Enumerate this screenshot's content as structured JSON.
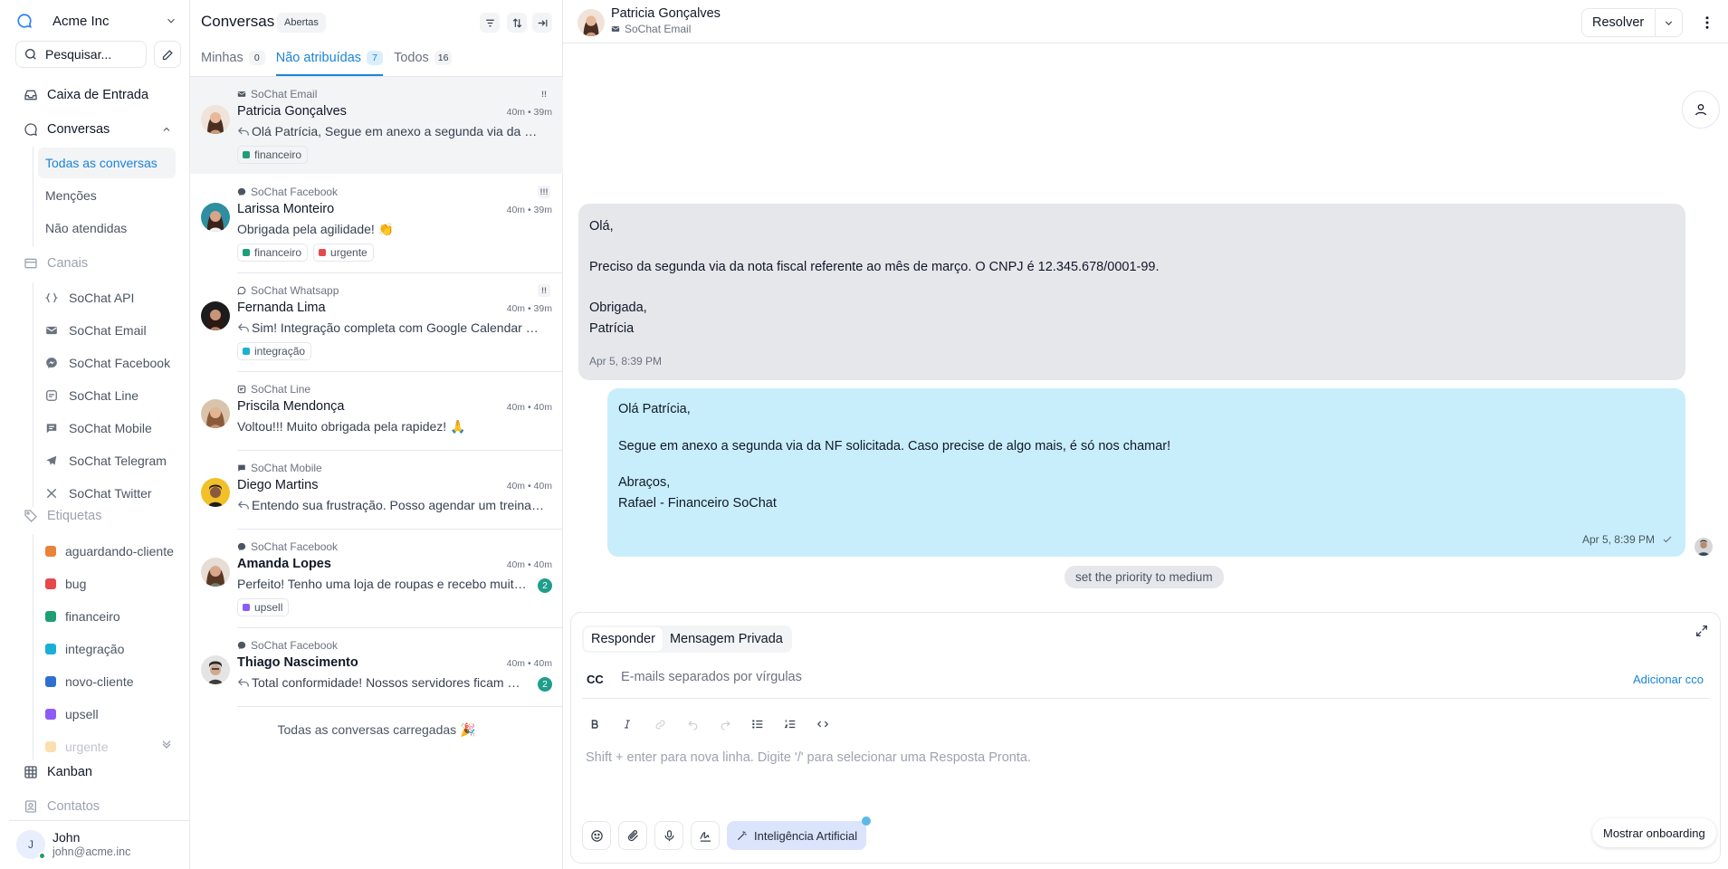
{
  "sidebar": {
    "account_name": "Acme Inc",
    "search_placeholder": "Pesquisar...",
    "inbox_label": "Caixa de Entrada",
    "conversations_label": "Conversas",
    "conversation_items": [
      "Todas as conversas",
      "Menções",
      "Não atendidas"
    ],
    "channels_label": "Canais",
    "channels": [
      {
        "label": "SoChat API",
        "icon": "api-icon"
      },
      {
        "label": "SoChat Email",
        "icon": "email-icon"
      },
      {
        "label": "SoChat Facebook",
        "icon": "messenger-icon"
      },
      {
        "label": "SoChat Line",
        "icon": "line-icon"
      },
      {
        "label": "SoChat Mobile",
        "icon": "chat-icon"
      },
      {
        "label": "SoChat Telegram",
        "icon": "telegram-icon"
      },
      {
        "label": "SoChat Twitter",
        "icon": "x-icon"
      }
    ],
    "labels_label": "Etiquetas",
    "labels": [
      {
        "label": "aguardando-cliente",
        "color": "#e8833a"
      },
      {
        "label": "bug",
        "color": "#e5484d"
      },
      {
        "label": "financeiro",
        "color": "#1f9e74"
      },
      {
        "label": "integração",
        "color": "#1ab0d6"
      },
      {
        "label": "novo-cliente",
        "color": "#2f6fcf"
      },
      {
        "label": "upsell",
        "color": "#8b5cf6"
      },
      {
        "label": "urgente",
        "color": "#f5a623"
      }
    ],
    "kanban_label": "Kanban",
    "contacts_label": "Contatos",
    "user": {
      "initial": "J",
      "name": "John",
      "email": "john@acme.inc"
    }
  },
  "conversation_list": {
    "title": "Conversas",
    "status_badge": "Abertas",
    "tabs": [
      {
        "label": "Minhas",
        "count": "0"
      },
      {
        "label": "Não atribuídas",
        "count": "7"
      },
      {
        "label": "Todos",
        "count": "16"
      }
    ],
    "conversations": [
      {
        "inbox": "SoChat Email",
        "name": "Patricia Gonçalves",
        "time": "40m • 39m",
        "message": "Olá Patrícia, Segue em anexo a segunda via da NF solicitada.",
        "labels": [
          {
            "text": "financeiro",
            "color": "#1f9e74"
          }
        ]
      },
      {
        "inbox": "SoChat Facebook",
        "name": "Larissa Monteiro",
        "time": "40m • 39m",
        "message": "Obrigada pela agilidade! 👏",
        "labels": [
          {
            "text": "financeiro",
            "color": "#1f9e74"
          },
          {
            "text": "urgente",
            "color": "#e5484d"
          }
        ]
      },
      {
        "inbox": "SoChat Whatsapp",
        "name": "Fernanda Lima",
        "time": "40m • 39m",
        "message": "Sim! Integração completa com Google Calendar e Outlook.",
        "labels": [
          {
            "text": "integração",
            "color": "#1ab0d6"
          }
        ]
      },
      {
        "inbox": "SoChat Line",
        "name": "Priscila Mendonça",
        "time": "40m • 40m",
        "message": "Voltou!!! Muito obrigada pela rapidez! 🙏",
        "labels": []
      },
      {
        "inbox": "SoChat Mobile",
        "name": "Diego Martins",
        "time": "40m • 40m",
        "message": "Entendo sua frustração. Posso agendar um treinamento?",
        "labels": []
      },
      {
        "inbox": "SoChat Facebook",
        "name": "Amanda Lopes",
        "time": "40m • 40m",
        "message": "Perfeito! Tenho uma loja de roupas e recebo muitas mensagens.",
        "labels": [
          {
            "text": "upsell",
            "color": "#8b5cf6"
          }
        ],
        "unread": "2"
      },
      {
        "inbox": "SoChat Facebook",
        "name": "Thiago Nascimento",
        "time": "40m • 40m",
        "message": "Total conformidade! Nossos servidores ficam no Brasil.",
        "labels": [],
        "unread": "2"
      }
    ],
    "end_message": "Todas as conversas carregadas 🎉"
  },
  "chat": {
    "contact_name": "Patricia Gonçalves",
    "inbox": "SoChat Email",
    "resolve_label": "Resolver",
    "incoming_lines": [
      "Olá,",
      "",
      "Preciso da segunda via da nota fiscal referente ao mês de março. O CNPJ é 12.345.678/0001-99.",
      "",
      "Obrigada,",
      "Patrícia"
    ],
    "incoming_time": "Apr 5, 8:39 PM",
    "outgoing_lines": [
      "Olá Patrícia,",
      "",
      "Segue em anexo a segunda via da NF solicitada. Caso precise de algo mais, é só nos chamar!",
      "",
      "Abraços,",
      "Rafael - Financeiro SoChat"
    ],
    "outgoing_time": "Apr 5, 8:39 PM",
    "activity": "set the priority to medium"
  },
  "reply_box": {
    "tab_reply": "Responder",
    "tab_private": "Mensagem Privada",
    "cc_label": "CC",
    "cc_placeholder": "E-mails separados por vírgulas",
    "add_bcc": "Adicionar cco",
    "editor_placeholder": "Shift + enter para nova linha. Digite '/' para selecionar uma Resposta Pronta.",
    "ai_label": "Inteligência Artificial",
    "onboarding_label": "Mostrar onboarding"
  }
}
